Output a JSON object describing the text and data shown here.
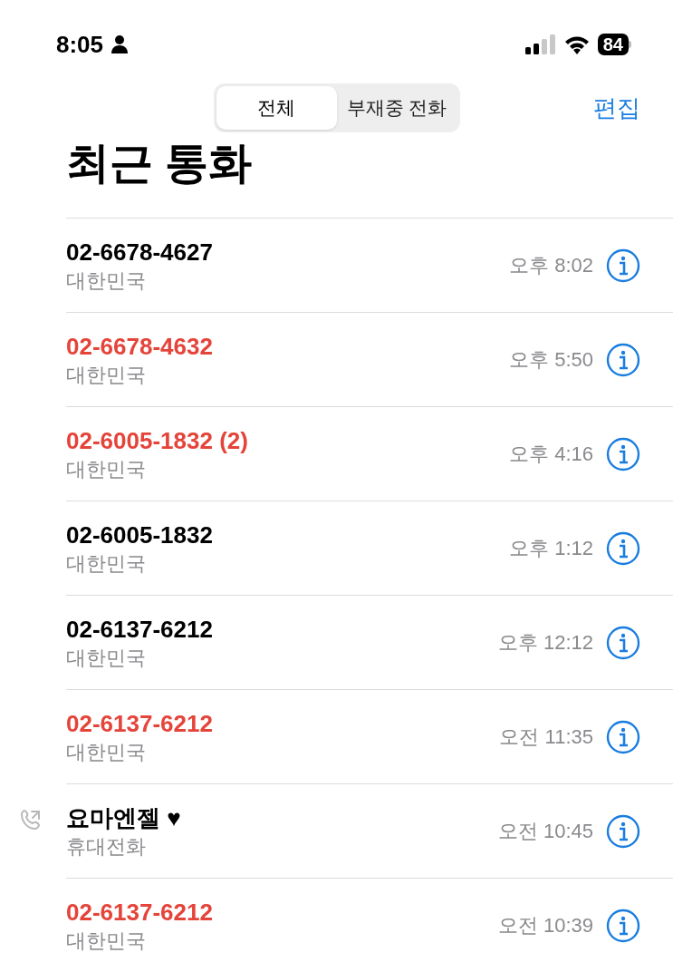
{
  "status_bar": {
    "time": "8:05",
    "battery": "84"
  },
  "segments": [
    {
      "label": "전체",
      "selected": true
    },
    {
      "label": "부재중 전화",
      "selected": false
    }
  ],
  "edit_button": "편집",
  "title": "최근 통화",
  "calls": [
    {
      "name": "02-6678-4627",
      "subtitle": "대한민국",
      "time": "오후 8:02",
      "missed": false,
      "outgoing": false
    },
    {
      "name": "02-6678-4632",
      "subtitle": "대한민국",
      "time": "오후 5:50",
      "missed": true,
      "outgoing": false
    },
    {
      "name": "02-6005-1832 (2)",
      "subtitle": "대한민국",
      "time": "오후 4:16",
      "missed": true,
      "outgoing": false
    },
    {
      "name": "02-6005-1832",
      "subtitle": "대한민국",
      "time": "오후 1:12",
      "missed": false,
      "outgoing": false
    },
    {
      "name": "02-6137-6212",
      "subtitle": "대한민국",
      "time": "오후 12:12",
      "missed": false,
      "outgoing": false
    },
    {
      "name": "02-6137-6212",
      "subtitle": "대한민국",
      "time": "오전 11:35",
      "missed": true,
      "outgoing": false
    },
    {
      "name": "요마엔젤 ♥",
      "subtitle": "휴대전화",
      "time": "오전 10:45",
      "missed": false,
      "outgoing": true
    },
    {
      "name": "02-6137-6212",
      "subtitle": "대한민국",
      "time": "오전 10:39",
      "missed": true,
      "outgoing": false
    }
  ]
}
